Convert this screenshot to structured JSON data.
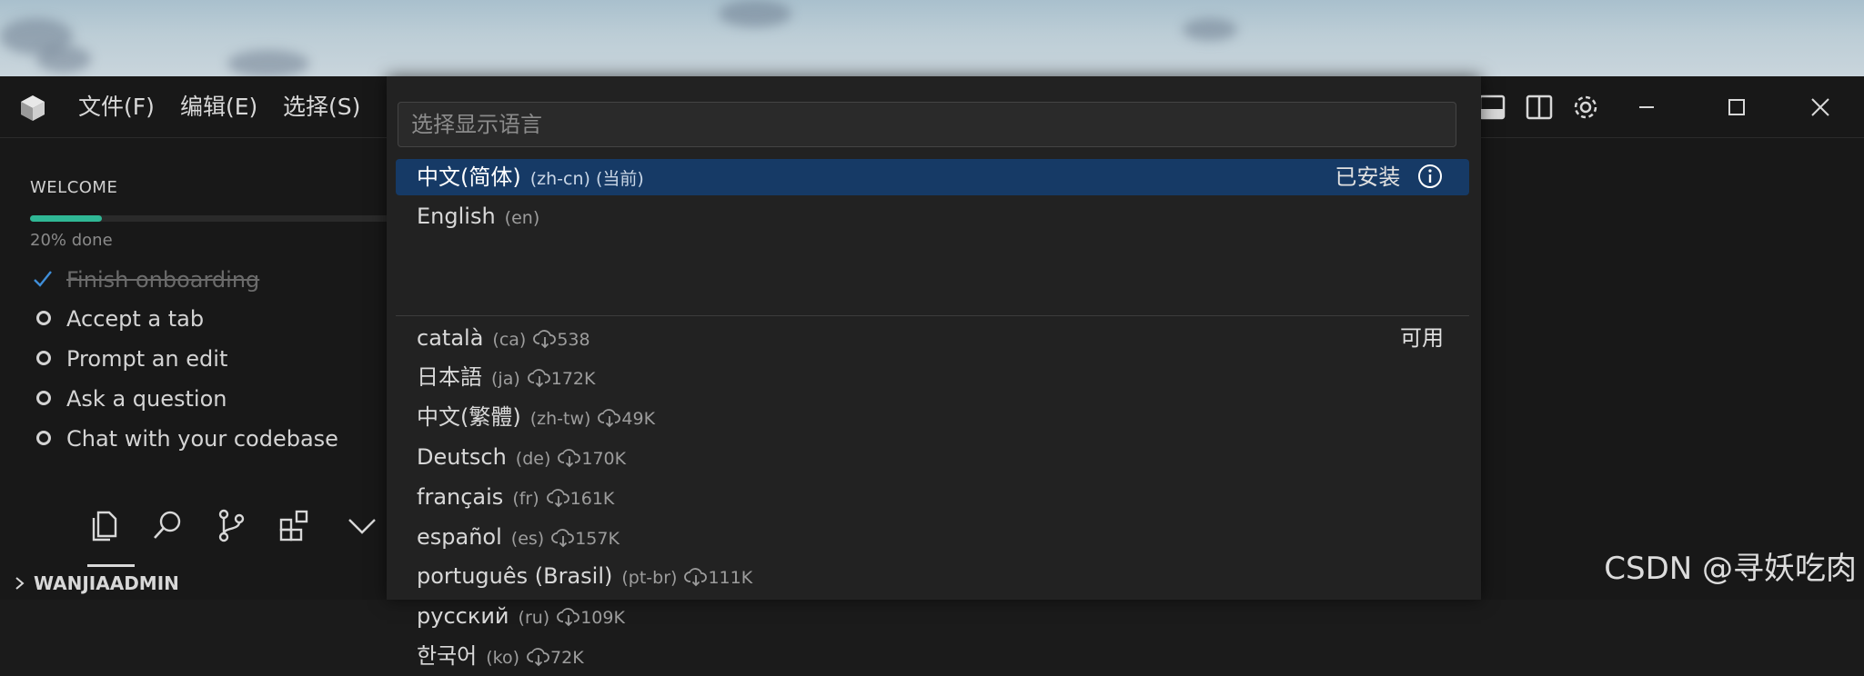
{
  "menu": {
    "file": "文件(F)",
    "edit": "编辑(E)",
    "select": "选择(S)"
  },
  "sidebar": {
    "welcome_title": "WELCOME",
    "progress_value": 0.2,
    "progress_text": "20% done",
    "tasks": [
      {
        "label": "Finish onboarding",
        "done": true
      },
      {
        "label": "Accept a tab",
        "done": false
      },
      {
        "label": "Prompt an edit",
        "done": false
      },
      {
        "label": "Ask a question",
        "done": false
      },
      {
        "label": "Chat with your codebase",
        "done": false
      }
    ],
    "activity_icons": [
      "files-icon",
      "search-icon",
      "source-control-icon",
      "extensions-icon",
      "chevron-down-icon"
    ],
    "explorer_folder": "WANJIAADMIN"
  },
  "quickpick": {
    "placeholder": "选择显示语言",
    "installed_label": "已安装",
    "available_label": "可用",
    "installed": [
      {
        "name": "中文(简体)",
        "code": "(zh-cn) (当前)"
      },
      {
        "name": "English",
        "code": "(en)"
      }
    ],
    "available": [
      {
        "name": "català",
        "code": "(ca)",
        "downloads": "538"
      },
      {
        "name": "日本語",
        "code": "(ja)",
        "downloads": "172K"
      },
      {
        "name": "中文(繁體)",
        "code": "(zh-tw)",
        "downloads": "49K"
      },
      {
        "name": "Deutsch",
        "code": "(de)",
        "downloads": "170K"
      },
      {
        "name": "français",
        "code": "(fr)",
        "downloads": "161K"
      },
      {
        "name": "español",
        "code": "(es)",
        "downloads": "157K"
      },
      {
        "name": "português (Brasil)",
        "code": "(pt-br)",
        "downloads": "111K"
      },
      {
        "name": "русский",
        "code": "(ru)",
        "downloads": "109K"
      },
      {
        "name": "한국어",
        "code": "(ko)",
        "downloads": "72K"
      }
    ]
  },
  "watermark": "CSDN @寻妖吃肉",
  "colors": {
    "accent": "#163a66",
    "progress": "#2fb795",
    "background": "#181818"
  }
}
